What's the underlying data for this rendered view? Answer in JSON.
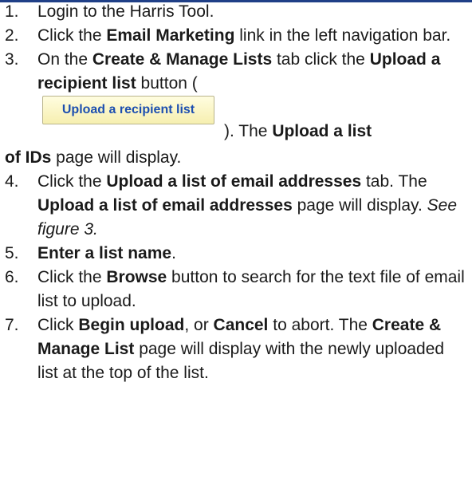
{
  "steps": [
    {
      "num": "1.",
      "a": "Login to the Harris Tool."
    },
    {
      "num": "2.",
      "a": "Click the ",
      "b1": "Email Marketing",
      "c": " link in the left navigation bar."
    },
    {
      "num": "3.",
      "a": "On the ",
      "b1": "Create & Manage Lists",
      "c": " tab click the ",
      "b2": "Upload a recipient list",
      "d": " button (",
      "button_label": "Upload a recipient list",
      "e": "). The ",
      "b3": "Upload a list",
      "b4": "of IDs",
      "f": " page will display."
    },
    {
      "num": "4.",
      "a": "Click the ",
      "b1": "Upload a list of email addresses",
      "c": " tab. The ",
      "b2": "Upload a list of email addresses",
      "d": " page will display. ",
      "i1": "See figure 3."
    },
    {
      "num": "5.",
      "b1": "Enter a list name",
      "a": "."
    },
    {
      "num": "6.",
      "a": "Click the ",
      "b1": "Browse",
      "c": " button to search for the text file of email list to upload."
    },
    {
      "num": "7.",
      "a": "Click ",
      "b1": "Begin upload",
      "c": ", or ",
      "b2": "Cancel",
      "d": " to abort. The ",
      "b3": "Create & Manage List",
      "e": " page will display with the newly uploaded list at the top of the list."
    }
  ]
}
